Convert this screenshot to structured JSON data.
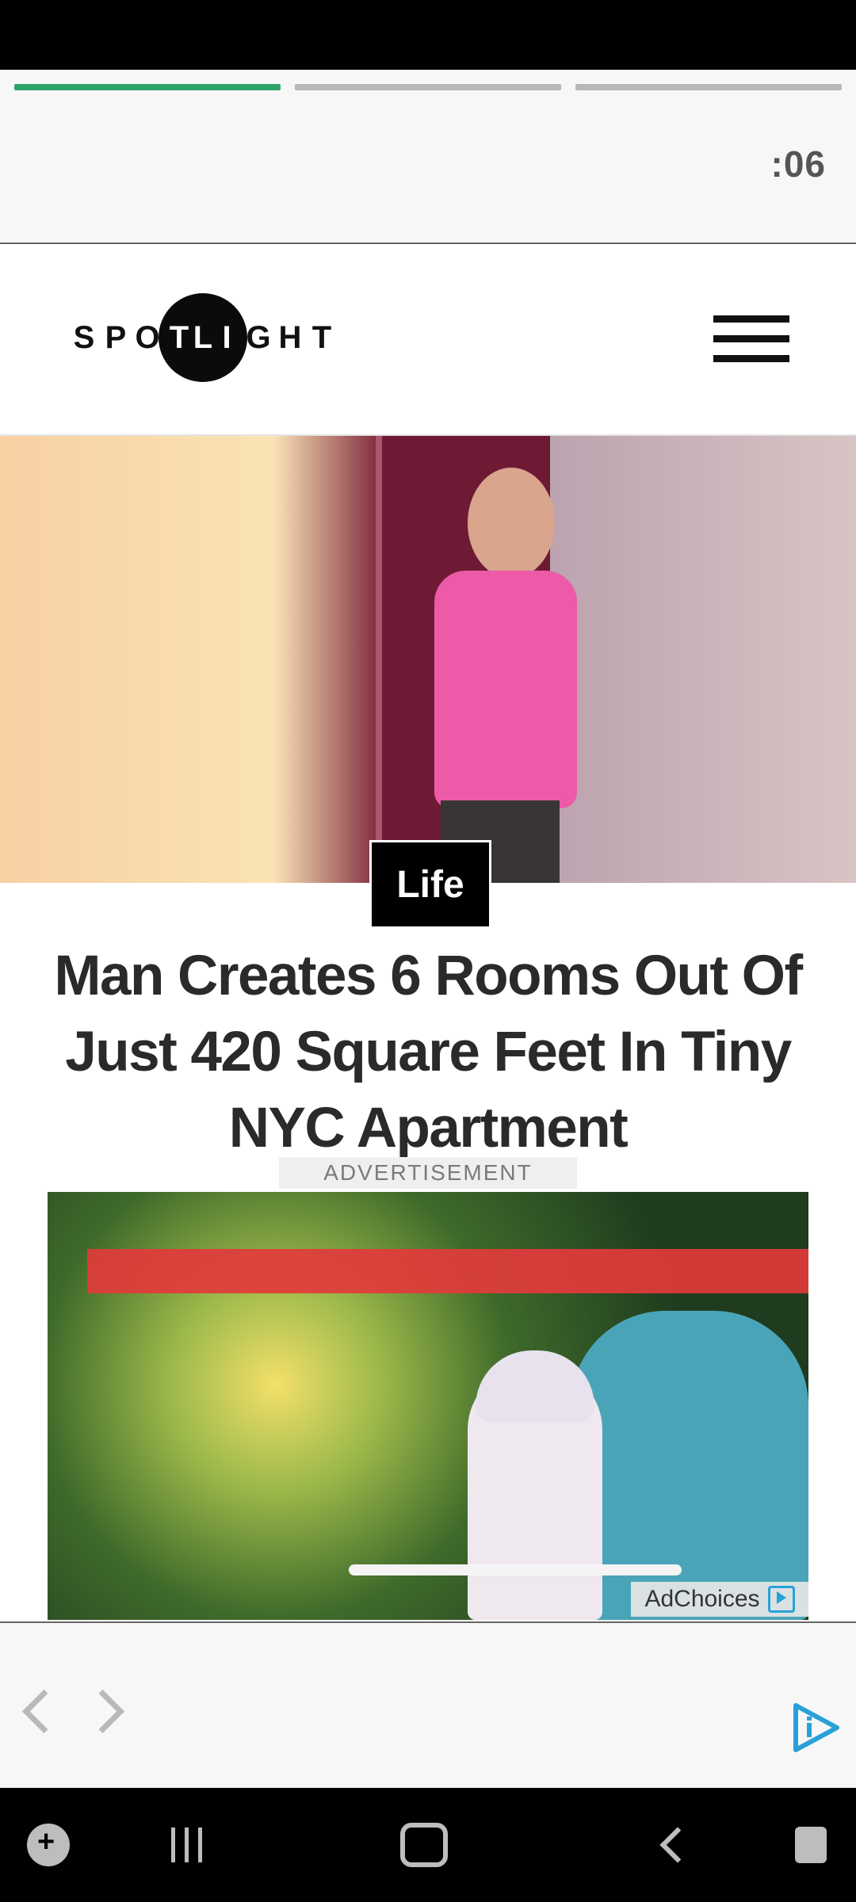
{
  "story": {
    "progress_segments": [
      {
        "state": "active"
      },
      {
        "state": "inactive"
      },
      {
        "state": "inactive"
      }
    ],
    "timer": ":06"
  },
  "site": {
    "logo_letters": [
      "S",
      "P",
      "O",
      "T",
      "L",
      "I",
      "G",
      "H",
      "T"
    ],
    "menu_icon": "hamburger-menu-icon"
  },
  "article": {
    "category": "Life",
    "headline": "Man Creates 6 Rooms Out Of Just 420 Square Feet In Tiny NYC Apartment",
    "hero_image": "man-in-pink-shirt-opening-door"
  },
  "ad": {
    "label": "ADVERTISEMENT",
    "image": "girl-on-bicycle-with-grandmother",
    "adchoices_label": "AdChoices"
  },
  "footer_nav": {
    "prev_icon": "chevron-left-icon",
    "next_icon": "chevron-right-icon",
    "brand_icon": "play-info-icon"
  },
  "system_nav": {
    "icons": [
      "game-launcher-icon",
      "recents-icon",
      "home-icon",
      "back-icon",
      "assistant-icon"
    ]
  },
  "colors": {
    "progress_active": "#2fa36b",
    "progress_inactive": "#b7b7b7",
    "brand_blue": "#2aa0d8"
  }
}
